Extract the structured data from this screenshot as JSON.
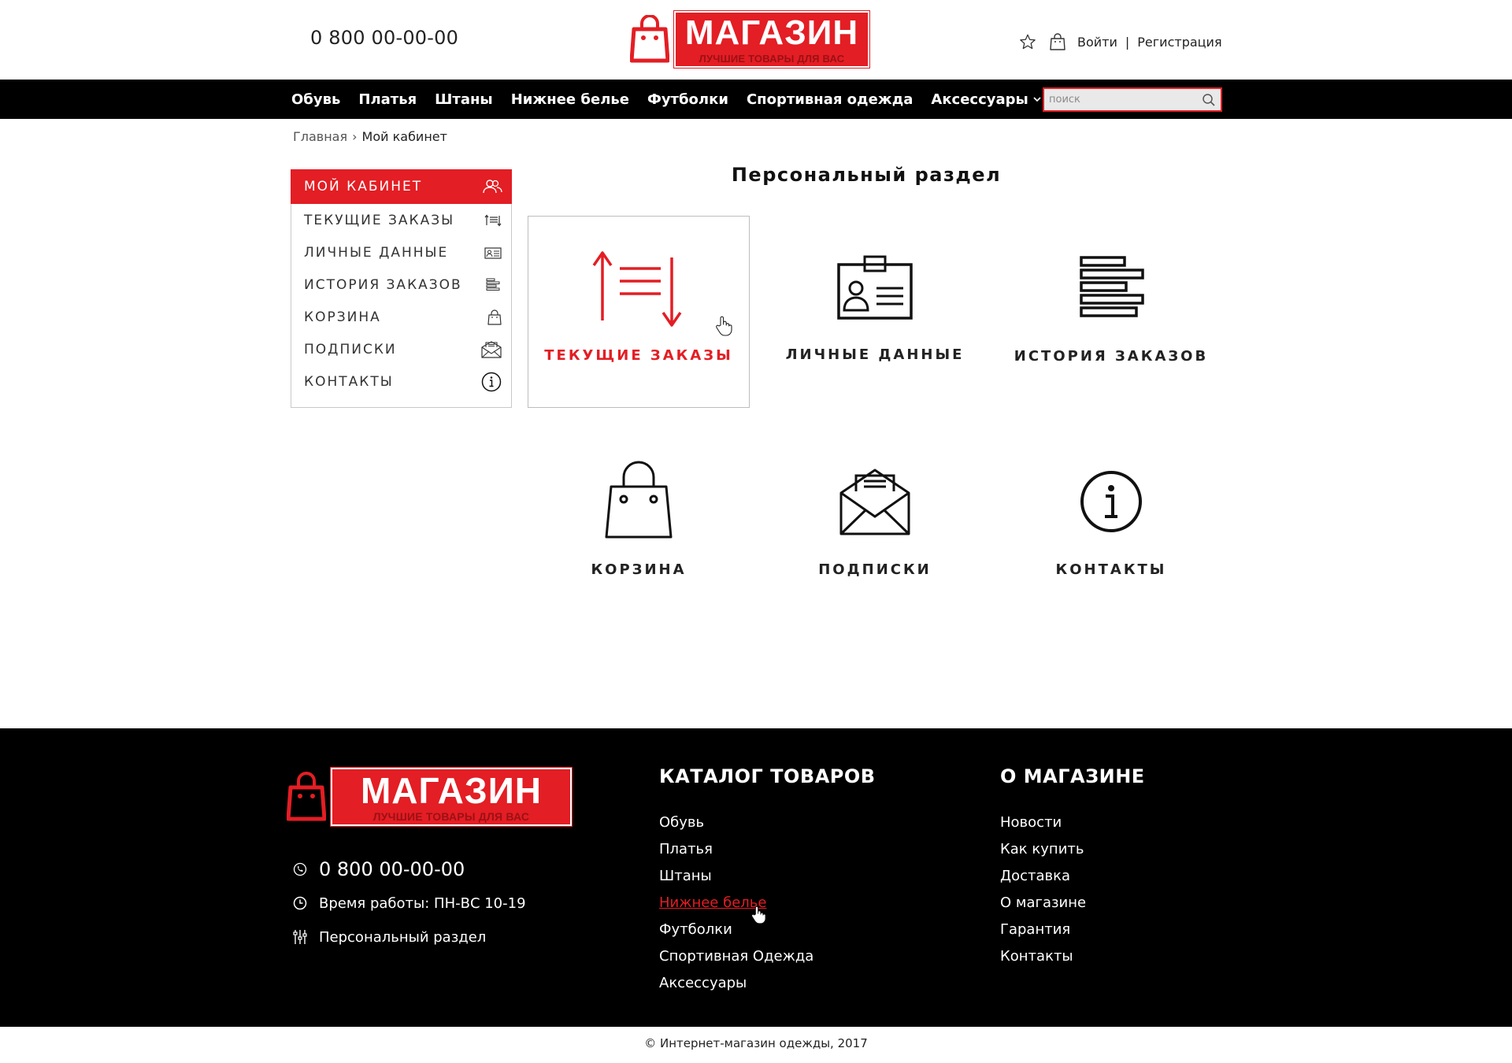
{
  "header": {
    "phone": "0 800 00-00-00",
    "logo": {
      "name": "МАГАЗИН",
      "slogan": "ЛУЧШИЕ ТОВАРЫ ДЛЯ ВАС"
    },
    "icons": {
      "favorites": "star-icon",
      "cart": "bag-icon"
    },
    "login": "Войти",
    "separator": "|",
    "register": "Регистрация"
  },
  "nav": {
    "items": [
      "Обувь",
      "Платья",
      "Штаны",
      "Нижнее белье",
      "Футболки",
      "Спортивная одежда",
      "Аксессуары"
    ],
    "search_placeholder": "поиск"
  },
  "breadcrumb": {
    "home": "Главная",
    "separator": "›",
    "current": "Мой кабинет"
  },
  "sidebar": {
    "items": [
      {
        "label": "МОЙ КАБИНЕТ",
        "icon": "users-icon",
        "active": true
      },
      {
        "label": "ТЕКУЩИЕ ЗАКАЗЫ",
        "icon": "sort-arrows-icon"
      },
      {
        "label": "ЛИЧНЫЕ ДАННЫЕ",
        "icon": "id-card-icon"
      },
      {
        "label": "ИСТОРИЯ ЗАКАЗОВ",
        "icon": "list-bars-icon"
      },
      {
        "label": "КОРЗИНА",
        "icon": "bag-icon"
      },
      {
        "label": "ПОДПИСКИ",
        "icon": "envelope-icon"
      },
      {
        "label": "КОНТАКТЫ",
        "icon": "info-icon"
      }
    ]
  },
  "main": {
    "title": "Персональный раздел",
    "tiles": [
      {
        "label": "ТЕКУЩИЕ ЗАКАЗЫ",
        "icon": "sort-arrows-icon",
        "active": true
      },
      {
        "label": "ЛИЧНЫЕ ДАННЫЕ",
        "icon": "id-card-icon"
      },
      {
        "label": "ИСТОРИЯ ЗАКАЗОВ",
        "icon": "list-bars-icon"
      },
      {
        "label": "КОРЗИНА",
        "icon": "bag-icon"
      },
      {
        "label": "ПОДПИСКИ",
        "icon": "envelope-icon"
      },
      {
        "label": "КОНТАКТЫ",
        "icon": "info-icon"
      }
    ]
  },
  "footer": {
    "logo": {
      "name": "МАГАЗИН",
      "slogan": "ЛУЧШИЕ ТОВАРЫ ДЛЯ ВАС"
    },
    "phone": "0 800 00-00-00",
    "hours": "Время работы: ПН-ВС 10-19",
    "personal": "Персональный раздел",
    "catalog": {
      "title": "КАТАЛОГ ТОВАРОВ",
      "items": [
        "Обувь",
        "Платья",
        "Штаны",
        "Нижнее белье",
        "Футболки",
        "Спортивная Одежда",
        "Аксессуары"
      ]
    },
    "about": {
      "title": "О МАГАЗИНЕ",
      "items": [
        "Новости",
        "Как купить",
        "Доставка",
        "О магазине",
        "Гарантия",
        "Контакты"
      ]
    }
  },
  "copyright": "© Интернет-магазин одежды, 2017",
  "colors": {
    "accent": "#e31e24",
    "dark": "#000000",
    "text": "#222222"
  }
}
